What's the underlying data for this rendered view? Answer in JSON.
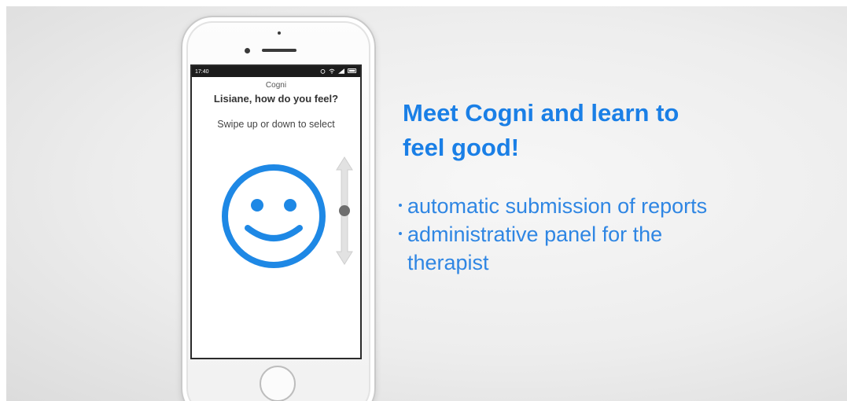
{
  "phone": {
    "status_time": "17:40",
    "status_icons": [
      "alarm-icon",
      "wifi-icon",
      "signal-icon",
      "battery-icon"
    ],
    "app_title": "Cogni",
    "question": "Lisiane, how do you feel?",
    "instruction": "Swipe up or down to select",
    "mood_icon": "smiley-face-icon",
    "selector_icon": "vertical-slider-icon"
  },
  "headline": {
    "line1": "Meet Cogni and learn to",
    "line2": "feel good!"
  },
  "bullets": {
    "item1": "automatic submission of reports",
    "item2_line1": "administrative panel for the",
    "item2_line2": "therapist"
  },
  "colors": {
    "accent": "#1a7fe6",
    "bullet_text": "#2f86e3",
    "smiley": "#1e88e5"
  }
}
